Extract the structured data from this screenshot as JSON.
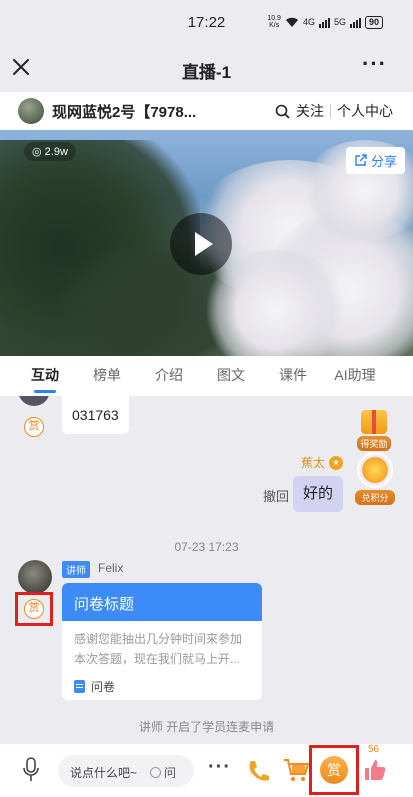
{
  "status_bar": {
    "time": "17:22",
    "net_speed_value": "10.9",
    "net_speed_unit": "K/s",
    "signal1": "4G",
    "signal2": "5G",
    "battery": "90"
  },
  "titlebar": {
    "title": "直播-1"
  },
  "channel": {
    "name": "现网蓝悦2号【7978...",
    "follow": "关注",
    "profile": "个人中心"
  },
  "video": {
    "views": "2.9w",
    "share": "分享"
  },
  "tabs": [
    {
      "label": "互动",
      "active": true
    },
    {
      "label": "榜单"
    },
    {
      "label": "介绍"
    },
    {
      "label": "图文"
    },
    {
      "label": "课件"
    },
    {
      "label": "AI助理"
    }
  ],
  "chat": {
    "reward_badge": "赏",
    "prev_message": "031763",
    "gift_label": "得奖励",
    "points_label": "兑积分",
    "my_name": "蕉太",
    "recall": "撤回",
    "my_message": "好的",
    "timestamp": "07-23 17:23",
    "teacher_role": "讲师",
    "teacher_name": "Felix",
    "card": {
      "title": "问卷标题",
      "body": "感谢您能抽出几分钟时间来参加本次答题，现在我们就马上开...",
      "type": "问卷"
    },
    "notice": "讲师 开启了学员连麦申请"
  },
  "bottom_bar": {
    "input_placeholder": "说点什么吧~",
    "question_toggle": "问",
    "reward_label": "赏",
    "like_count": "56"
  },
  "colors": {
    "accent": "#3d8bf6",
    "reward": "#f08a24",
    "highlight": "#e02020"
  }
}
